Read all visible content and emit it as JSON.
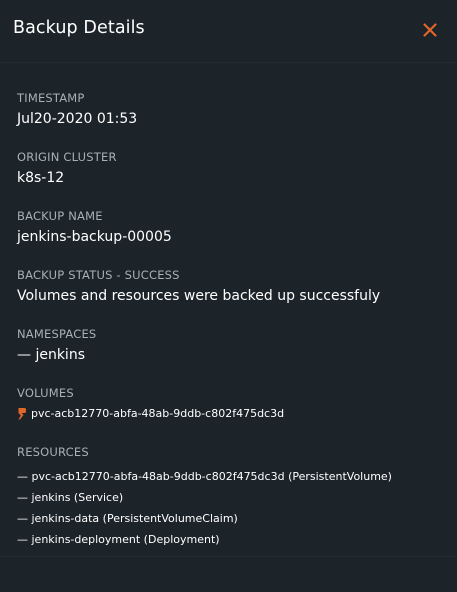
{
  "panel": {
    "title": "Backup Details"
  },
  "colors": {
    "background": "#1c2329",
    "accent": "#e0662a",
    "label": "#a7b1b9",
    "text": "#ffffff"
  },
  "icons": {
    "close": "close-icon",
    "volume": "portworx-volume-icon"
  },
  "fields": {
    "timestamp": {
      "label": "TIMESTAMP",
      "value": "Jul20-2020 01:53"
    },
    "origin_cluster": {
      "label": "ORIGIN CLUSTER",
      "value": "k8s-12"
    },
    "backup_name": {
      "label": "BACKUP NAME",
      "value": "jenkins-backup-00005"
    },
    "backup_status": {
      "label": "BACKUP STATUS - SUCCESS",
      "value": "Volumes and resources were backed up successfuly"
    },
    "namespaces": {
      "label": "NAMESPACES",
      "value": "— jenkins"
    },
    "volumes": {
      "label": "VOLUMES",
      "items": [
        "pvc-acb12770-abfa-48ab-9ddb-c802f475dc3d"
      ]
    },
    "resources": {
      "label": "RESOURCES",
      "items": [
        "— pvc-acb12770-abfa-48ab-9ddb-c802f475dc3d (PersistentVolume)",
        "— jenkins (Service)",
        "— jenkins-data (PersistentVolumeClaim)",
        "— jenkins-deployment (Deployment)"
      ]
    }
  }
}
